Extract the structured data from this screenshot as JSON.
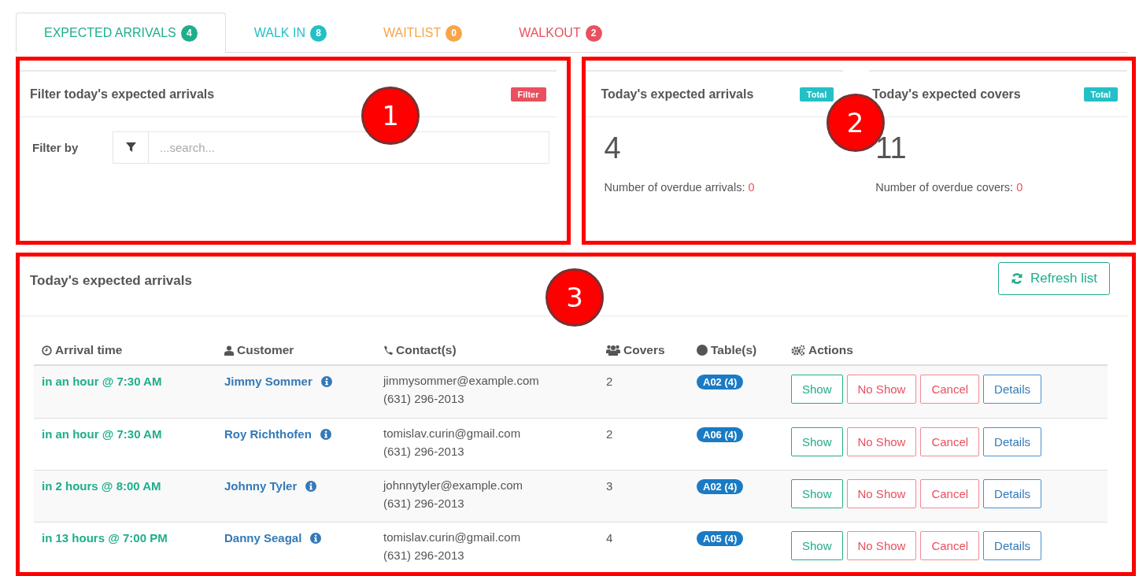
{
  "tabs": [
    {
      "label": "EXPECTED ARRIVALS",
      "count": "4",
      "color": "#1fae8c",
      "selected": true
    },
    {
      "label": "WALK IN",
      "count": "8",
      "color": "#23c0c6",
      "selected": false
    },
    {
      "label": "WAITLIST",
      "count": "0",
      "color": "#f7a54a",
      "selected": false
    },
    {
      "label": "WALKOUT",
      "count": "2",
      "color": "#e9505f",
      "selected": false
    }
  ],
  "filter_panel": {
    "callout": "1",
    "title": "Filter today's expected arrivals",
    "badge": "Filter",
    "field_label": "Filter by",
    "search": {
      "placeholder": "...search..."
    }
  },
  "stats_panel": {
    "callout": "2",
    "cards": [
      {
        "title": "Today's expected arrivals",
        "badge": "Total",
        "value": "4",
        "overdue_label": "Number of overdue arrivals:",
        "overdue_value": "0"
      },
      {
        "title": "Today's expected covers",
        "badge": "Total",
        "value": "11",
        "overdue_label": "Number of overdue covers:",
        "overdue_value": "0"
      }
    ]
  },
  "arrivals_panel": {
    "callout": "3",
    "title": "Today's expected arrivals",
    "refresh_button": "Refresh list",
    "columns": [
      "Arrival time",
      "Customer",
      "Contact(s)",
      "Covers",
      "Table(s)",
      "Actions"
    ],
    "rows": [
      {
        "arrival": "in an hour @ 7:30 AM",
        "customer": "Jimmy Sommer",
        "email": "jimmysommer@example.com",
        "phone": "(631) 296-2013",
        "covers": "2",
        "table": "A02 (4)",
        "actions": [
          {
            "label": "Show",
            "kind": "success"
          },
          {
            "label": "No Show",
            "kind": "danger"
          },
          {
            "label": "Cancel",
            "kind": "danger"
          },
          {
            "label": "Details",
            "kind": "primary"
          }
        ]
      },
      {
        "arrival": "in an hour @ 7:30 AM",
        "customer": "Roy Richthofen",
        "email": "tomislav.curin@gmail.com",
        "phone": "(631) 296-2013",
        "covers": "2",
        "table": "A06 (4)",
        "actions": [
          {
            "label": "Show",
            "kind": "success"
          },
          {
            "label": "No Show",
            "kind": "danger"
          },
          {
            "label": "Cancel",
            "kind": "danger"
          },
          {
            "label": "Details",
            "kind": "primary"
          }
        ]
      },
      {
        "arrival": "in 2 hours @ 8:00 AM",
        "customer": "Johnny Tyler",
        "email": "johnnytyler@example.com",
        "phone": "(631) 296-2013",
        "covers": "3",
        "table": "A02 (4)",
        "actions": [
          {
            "label": "Show",
            "kind": "success"
          },
          {
            "label": "No Show",
            "kind": "danger"
          },
          {
            "label": "Cancel",
            "kind": "danger"
          },
          {
            "label": "Details",
            "kind": "primary"
          }
        ]
      },
      {
        "arrival": "in 13 hours @ 7:00 PM",
        "customer": "Danny Seagal",
        "email": "tomislav.curin@gmail.com",
        "phone": "(631) 296-2013",
        "covers": "4",
        "table": "A05 (4)",
        "actions": [
          {
            "label": "Show",
            "kind": "success"
          },
          {
            "label": "No Show",
            "kind": "danger"
          },
          {
            "label": "Cancel",
            "kind": "danger"
          },
          {
            "label": "Details",
            "kind": "primary"
          }
        ]
      }
    ]
  }
}
